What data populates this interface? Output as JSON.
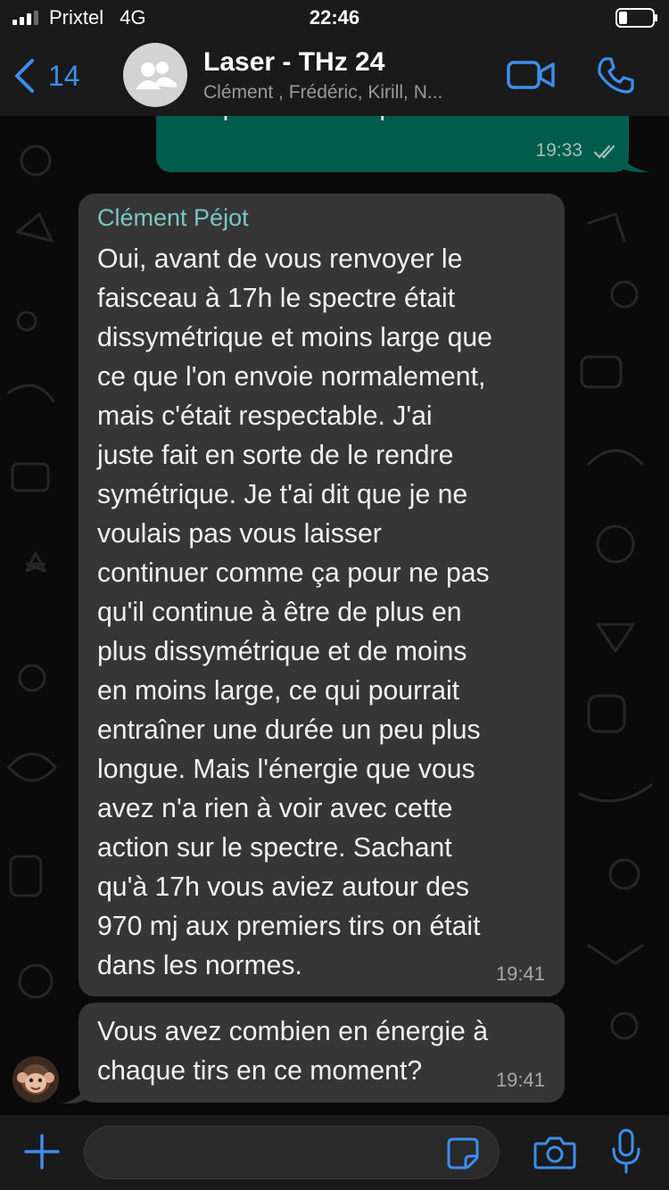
{
  "status_bar": {
    "carrier": "Prixtel",
    "network": "4G",
    "time": "22:46",
    "signal_bars": 3,
    "signal_icon": "signal-bars-icon",
    "battery_icon": "battery-icon"
  },
  "header": {
    "back_icon": "chevron-left-icon",
    "back_count": "14",
    "title": "Laser - THz 24",
    "subtitle": "Clément , Frédéric, Kirill, N...",
    "video_icon": "video-camera-icon",
    "call_icon": "phone-icon"
  },
  "messages": [
    {
      "direction": "outgoing",
      "text_partial": "comparer avec le précédent ?",
      "time": "19:33",
      "status": "read"
    },
    {
      "direction": "incoming",
      "sender": "Clément  Péjot",
      "text": "Oui, avant de vous renvoyer le\nfaisceau à 17h le spectre était\ndissymétrique et moins large que\nce que l'on envoie normalement,\nmais c'était respectable. J'ai\njuste fait en sorte de le rendre\nsymétrique. Je t'ai dit que je ne\nvoulais pas vous laisser\ncontinuer comme ça pour ne pas\nqu'il continue à être de plus en\nplus dissymétrique et de moins\nen moins large, ce qui pourrait\nentraîner une durée un peu plus\nlongue. Mais l'énergie que vous\navez n'a rien à voir avec cette\naction sur le spectre. Sachant\nqu'à 17h vous aviez autour des\n970 mj aux premiers tirs on était\ndans les normes.",
      "time": "19:41"
    },
    {
      "direction": "incoming",
      "text": "Vous avez combien en énergie à\nchaque tirs en ce moment?",
      "time": "19:41"
    }
  ],
  "input_bar": {
    "plus_icon": "plus-icon",
    "placeholder": "",
    "sticker_icon": "sticker-icon",
    "camera_icon": "camera-icon",
    "mic_icon": "microphone-icon"
  },
  "colors": {
    "accent": "#3d8ef0",
    "outgoing_bubble": "#005c4b",
    "incoming_bubble": "#363636",
    "sender_name": "#7ac6c0",
    "background": "#0a0a0a"
  }
}
